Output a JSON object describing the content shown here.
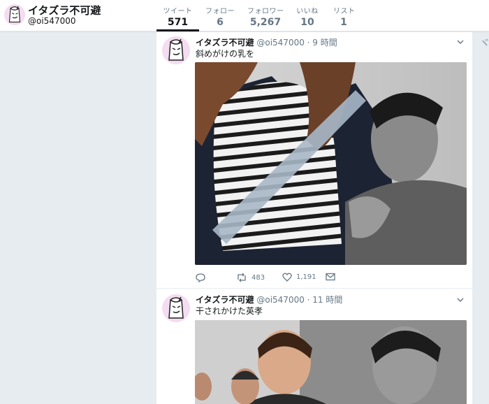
{
  "profile": {
    "name": "イタズラ不可避",
    "handle": "@oi547000"
  },
  "nav": {
    "tweets": {
      "label": "ツイート",
      "value": "571"
    },
    "following": {
      "label": "フォロー",
      "value": "6"
    },
    "followers": {
      "label": "フォロワー",
      "value": "5,267"
    },
    "likes": {
      "label": "いいね",
      "value": "10"
    },
    "lists": {
      "label": "リスト",
      "value": "1"
    }
  },
  "tweets": [
    {
      "name": "イタズラ不可避",
      "meta": "@oi547000 · 9 時間",
      "text": "斜めがけの乳を",
      "retweets": "483",
      "likes": "1,191"
    },
    {
      "name": "イタズラ不可避",
      "meta": "@oi547000 · 11 時間",
      "text": "干されかけた英孝"
    }
  ],
  "side": {
    "glyph": "ヾ"
  },
  "icons": [
    "avatar-cartoon",
    "chevron-down-icon",
    "reply-icon",
    "retweet-icon",
    "heart-icon",
    "dm-icon"
  ],
  "colors": {
    "accent": "#14171a",
    "muted": "#657786",
    "background": "#e6ecf0",
    "avatar_bg": "#f6e6f4"
  }
}
